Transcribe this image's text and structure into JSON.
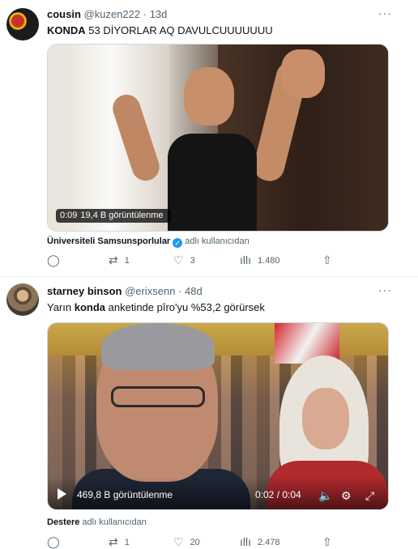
{
  "tweets": [
    {
      "name": "cousin",
      "handle": "@kuzen222",
      "time": "13d",
      "text_bold": "KONDA",
      "text_rest": " 53 DİYORLAR AQ DAVULCUUUUUUU",
      "media": {
        "time_badge": "0:09",
        "views_badge": "19,4 B görüntülenme"
      },
      "source_name": "Üniversiteli Samsunsporlular",
      "source_suffix": "adlı kullanıcıdan",
      "replies": "",
      "retweets": "1",
      "likes": "3",
      "views": "1.480"
    },
    {
      "name": "starney binson",
      "handle": "@erixsenn",
      "time": "48d",
      "text_pre": "Yarın ",
      "text_bold": "konda",
      "text_rest": " anketinde pîro'yu %53,2 görürsek",
      "media": {
        "views_text": "469,8 B görüntülenme",
        "time_text": "0:02 / 0:04"
      },
      "source_name": "Destere",
      "source_suffix": "adlı kullanıcıdan",
      "replies": "",
      "retweets": "1",
      "likes": "20",
      "views": "2.478"
    }
  ],
  "icons": {
    "more": "···",
    "reply": "◯",
    "retweet": "⇄",
    "like": "♡",
    "views": "ıllı",
    "share": "⇧",
    "verified": "✓",
    "volume": "🔈",
    "gear": "⚙",
    "fullscreen": "⤢"
  }
}
